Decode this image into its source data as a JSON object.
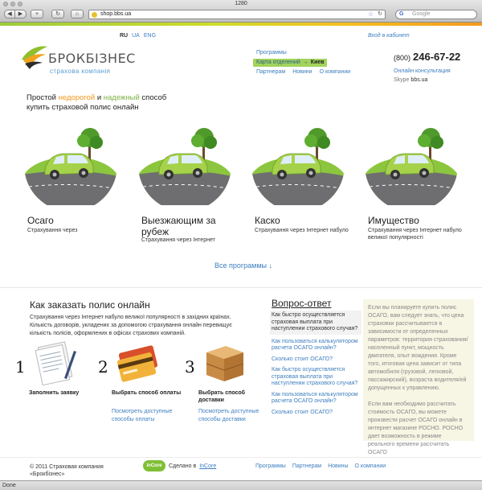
{
  "browser": {
    "window_title": "1280",
    "url": "shop.bbs.ua",
    "search_placeholder": "Google",
    "status": "Done"
  },
  "header": {
    "languages": [
      "RU",
      "UA",
      "ENG"
    ],
    "current_language": "RU",
    "cabinet_link": "Вход в кабинет",
    "logo_name": "БРОКБІЗНЕС",
    "logo_sub": "страхова компанія",
    "nav": {
      "programs": "Программы",
      "map": "Карта отделений",
      "city": "Киев",
      "partners": "Партнерам",
      "news": "Новини",
      "about": "О компании"
    },
    "phone_code": "(800)",
    "phone_number": "246-67-22",
    "consult_link": "Онлайн консультация",
    "skype_label": "Skype",
    "skype_value": "bbs.ua"
  },
  "tagline": {
    "part1": "Простой ",
    "cheap": "недорогой",
    "part2": " и ",
    "reliable": "надежный",
    "part3": " способ купить страховой полис онлайн"
  },
  "products": [
    {
      "title": "Осаго",
      "desc": "Страхування через"
    },
    {
      "title": "Выезжающим за рубеж",
      "desc": "Страхування через Інтернет"
    },
    {
      "title": "Каско",
      "desc": "Страхування через Інтернет набуло"
    },
    {
      "title": "Имущество",
      "desc": "Страхування через Інтернет набуло великої популярності"
    }
  ],
  "all_programs": "Все программы ↓",
  "howto": {
    "title": "Как заказать полис онлайн",
    "text": "Страхування через Інтернет набуло великої популярності в західних країнах. Кількість договорів, укладених за допомогою страхування онлайн перевищує кількість полісів, оформлених в офісах страхових компаній.",
    "steps": [
      {
        "num": "1",
        "title": "Заполнить заявку",
        "links": []
      },
      {
        "num": "2",
        "title": "Выбрать способ оплаты",
        "links": [
          "Посмотреть доступные способы оплаты"
        ]
      },
      {
        "num": "3",
        "title": "Выбрать способ доставки",
        "links": [
          "Посмотреть доступные способы доставки"
        ]
      }
    ]
  },
  "faq": {
    "title": "Вопрос-ответ",
    "items": [
      "Как быстро осуществляется страховая выплата при наступлении страхового случая?",
      "Как пользоваться калькулятором расчета ОСАГО онлайн?",
      "Сколько стоит ОСАГО?",
      "Как быстро осуществляется страховая выплата при наступлении страхового случая?",
      "Как пользоваться калькулятором расчета ОСАГО онлайн?",
      "Сколько стоит ОСАГО?"
    ],
    "answer_p1": "Если вы планируете купить полис ОСАГО, вам следует знать, что цена страховки рассчитывается в зависимости от определенных параметров: территория страхования/населенный пункт, мощность двигателя, опыт вождения. Кроме того, итоговая цена зависит от типа автомобиля (грузовой, легковой, пассажирский), возраста водителя/ей допущенных к управлению.",
    "answer_p2": "Если вам необходимо рассчитать стоимость ОСАГО, вы можете произвести расчет ОСАГО онлайн в интернет магазине РОСНО. РОСНО дает возможность в режиме реального времени рассчитать ОСАГО"
  },
  "footer": {
    "copyright": "© 2011 Страховая компания «Брокбізнес»",
    "badge": "inCore",
    "made_by": "Сделано в",
    "maker": "InCore",
    "nav": [
      "Программы",
      "Партнерам",
      "Новины",
      "О компании"
    ]
  },
  "colors": {
    "link": "#3d7ebf",
    "accent_green": "#a2d45c",
    "accent_orange": "#f2961d"
  }
}
